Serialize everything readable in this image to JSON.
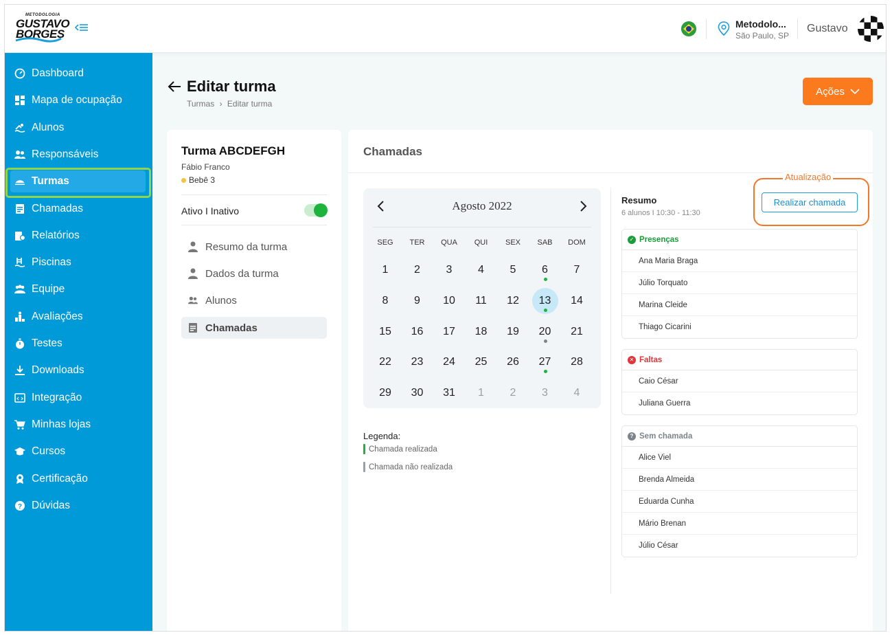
{
  "header": {
    "logo_small": "METODOLOGIA",
    "logo_line1": "GUSTAVO",
    "logo_line2": "BORGES",
    "location_name": "Metodolo...",
    "location_city": "São Paulo, SP",
    "user_name": "Gustavo"
  },
  "sidebar": {
    "items": [
      {
        "label": "Dashboard",
        "icon": "dashboard-icon"
      },
      {
        "label": "Mapa de ocupação",
        "icon": "grid-icon"
      },
      {
        "label": "Alunos",
        "icon": "swimmer-icon"
      },
      {
        "label": "Responsáveis",
        "icon": "users-icon"
      },
      {
        "label": "Turmas",
        "icon": "swim-cap-icon"
      },
      {
        "label": "Chamadas",
        "icon": "clipboard-icon"
      },
      {
        "label": "Relatórios",
        "icon": "report-icon"
      },
      {
        "label": "Piscinas",
        "icon": "pool-icon"
      },
      {
        "label": "Equipe",
        "icon": "team-icon"
      },
      {
        "label": "Avaliações",
        "icon": "podium-icon"
      },
      {
        "label": "Testes",
        "icon": "stopwatch-icon"
      },
      {
        "label": "Downloads",
        "icon": "download-icon"
      },
      {
        "label": "Integração",
        "icon": "code-window-icon"
      },
      {
        "label": "Minhas lojas",
        "icon": "cart-icon"
      },
      {
        "label": "Cursos",
        "icon": "graduation-cap-icon"
      },
      {
        "label": "Certificação",
        "icon": "award-icon"
      },
      {
        "label": "Dúvidas",
        "icon": "help-icon"
      }
    ],
    "active": "Turmas"
  },
  "page": {
    "title": "Editar turma",
    "breadcrumb_root": "Turmas",
    "breadcrumb_current": "Editar turma",
    "actions_label": "Ações"
  },
  "turma": {
    "name": "Turma ABCDEFGH",
    "teacher": "Fábio Franco",
    "level": "Bebê 3",
    "status_label": "Ativo I Inativo",
    "status_active": true,
    "menu": [
      "Resumo da turma",
      "Dados da turma",
      "Alunos",
      "Chamadas"
    ],
    "menu_active": "Chamadas"
  },
  "main": {
    "title": "Chamadas"
  },
  "calendar": {
    "month_label": "Agosto 2022",
    "weekdays": [
      "SEG",
      "TER",
      "QUA",
      "QUI",
      "SEX",
      "SAB",
      "DOM"
    ],
    "weeks": [
      [
        1,
        2,
        3,
        4,
        5,
        6,
        7
      ],
      [
        8,
        9,
        10,
        11,
        12,
        13,
        14
      ],
      [
        15,
        16,
        17,
        18,
        19,
        20,
        21
      ],
      [
        22,
        23,
        24,
        25,
        26,
        27,
        28
      ],
      [
        29,
        30,
        31,
        1,
        2,
        3,
        4
      ]
    ],
    "muted_last_row_from": 3,
    "today": 13,
    "marks": {
      "6": "done",
      "13": "done",
      "20": "pending",
      "27": "done"
    },
    "colors": {
      "done": "#1db33c",
      "pending": "#7f868b"
    }
  },
  "legend": {
    "title": "Legenda:",
    "done": "Chamada realizada",
    "pending": "Chamada não realizada"
  },
  "summary": {
    "title": "Resumo",
    "subtitle": "6 alunos I  10:30 - 11:30",
    "update_label": "Atualização",
    "call_button": "Realizar chamada",
    "groups": [
      {
        "title": "Presenças",
        "color": "#1a9c3a",
        "names": [
          "Ana Maria Braga",
          "Júlio Torquato",
          "Marina Cleide",
          "Thiago Cicarini"
        ]
      },
      {
        "title": "Faltas",
        "color": "#e0363a",
        "names": [
          "Caio César",
          "Juliana Guerra"
        ]
      },
      {
        "title": "Sem chamada",
        "color": "#7c848a",
        "names": [
          "Alice Viel",
          "Brenda Almeida",
          "Eduarda Cunha",
          "Mário Brenan",
          "Júlio César"
        ]
      }
    ]
  }
}
